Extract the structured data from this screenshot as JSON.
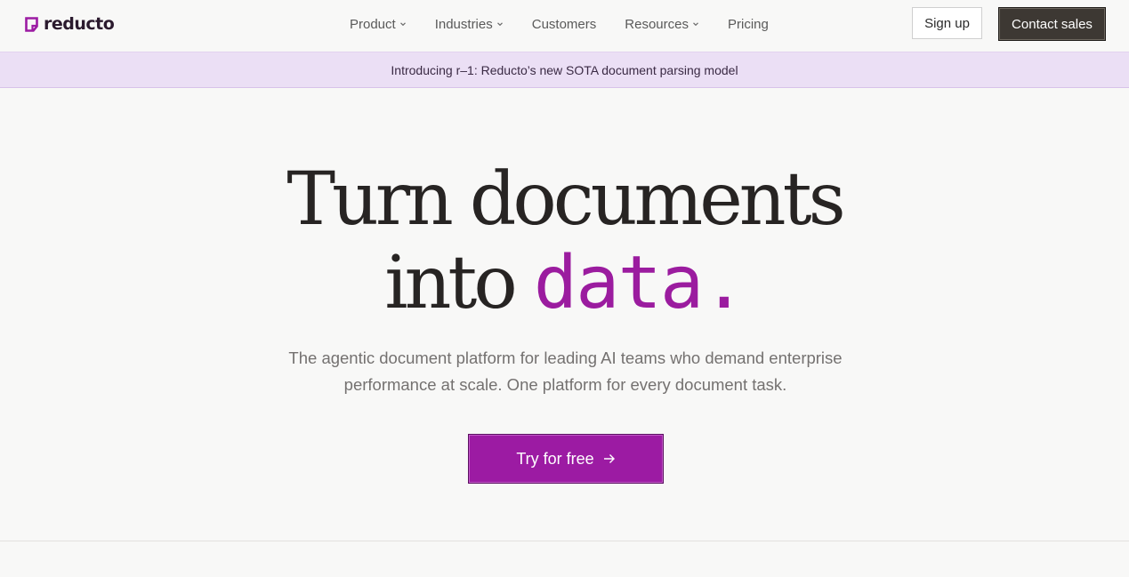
{
  "header": {
    "logo_text": "reducto",
    "nav": [
      {
        "label": "Product",
        "has_dropdown": true
      },
      {
        "label": "Industries",
        "has_dropdown": true
      },
      {
        "label": "Customers",
        "has_dropdown": false
      },
      {
        "label": "Resources",
        "has_dropdown": true
      },
      {
        "label": "Pricing",
        "has_dropdown": false
      }
    ],
    "signup_label": "Sign up",
    "contact_label": "Contact sales"
  },
  "announcement": {
    "text": "Introducing r–1: Reducto’s new SOTA document parsing model"
  },
  "hero": {
    "title_line1": "Turn documents",
    "title_line2_prefix": "into",
    "title_accent": "data.",
    "subtitle": "The agentic document platform for leading AI teams who demand enterprise performance at scale. One platform for every document task.",
    "cta_label": "Try for free"
  },
  "colors": {
    "brand_purple": "#9c1ba3",
    "announcement_bg": "#ebdff5",
    "dark_button": "#3d3833",
    "page_bg": "#f8f8f7"
  },
  "icons": {
    "logo": "reducto-logo-icon",
    "dropdown": "chevron-down-icon",
    "cta": "arrow-right-icon"
  }
}
